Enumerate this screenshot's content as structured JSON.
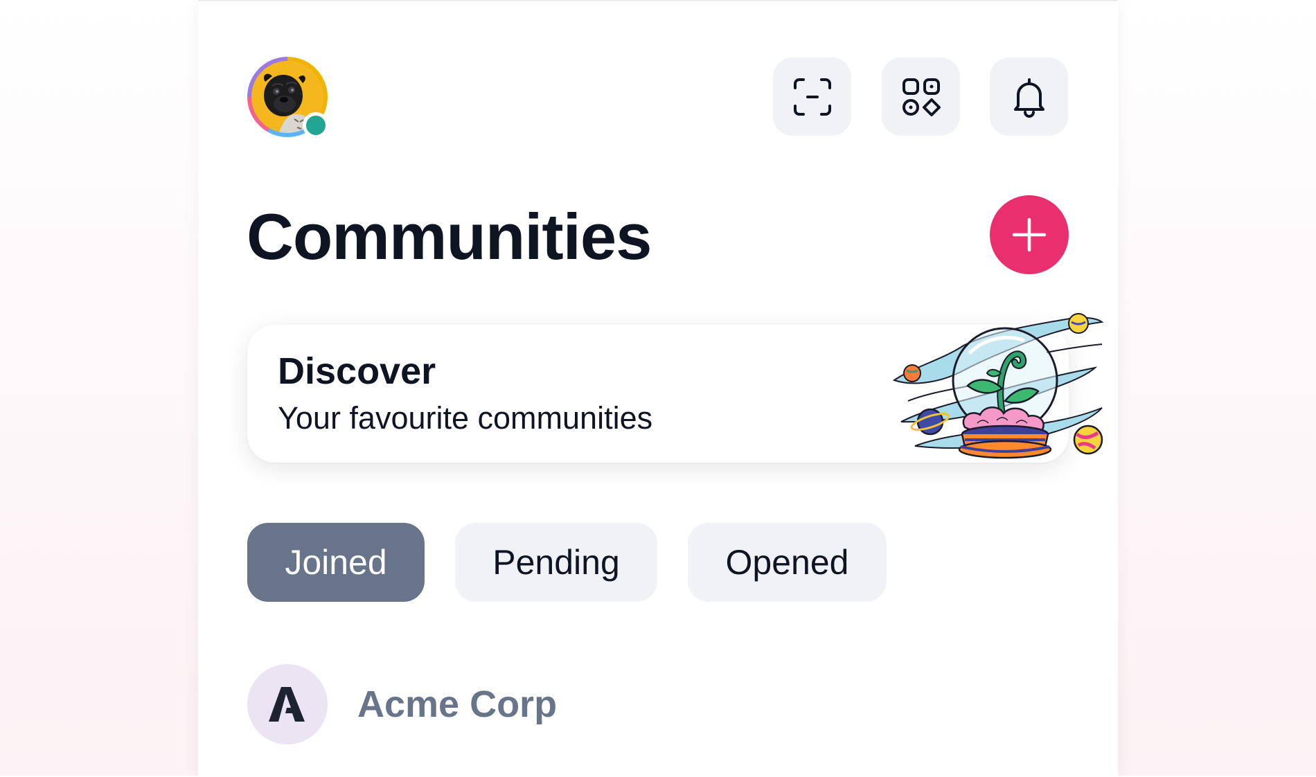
{
  "header": {
    "avatar_alt": "User avatar",
    "status": "online",
    "actions": [
      {
        "name": "scan",
        "icon": "scan-icon"
      },
      {
        "name": "apps",
        "icon": "apps-icon"
      },
      {
        "name": "notifications",
        "icon": "bell-icon"
      }
    ]
  },
  "page": {
    "title": "Communities",
    "add_icon": "plus-icon"
  },
  "discover": {
    "title": "Discover",
    "subtitle": "Your favourite communities"
  },
  "tabs": [
    {
      "label": "Joined",
      "active": true
    },
    {
      "label": "Pending",
      "active": false
    },
    {
      "label": "Opened",
      "active": false
    }
  ],
  "communities": [
    {
      "name": "Acme Corp",
      "logo_letter": "A"
    }
  ],
  "colors": {
    "accent": "#ea2f6f",
    "active_tab": "#67748a",
    "status_online": "#23a594",
    "text_primary": "#0e1422"
  }
}
